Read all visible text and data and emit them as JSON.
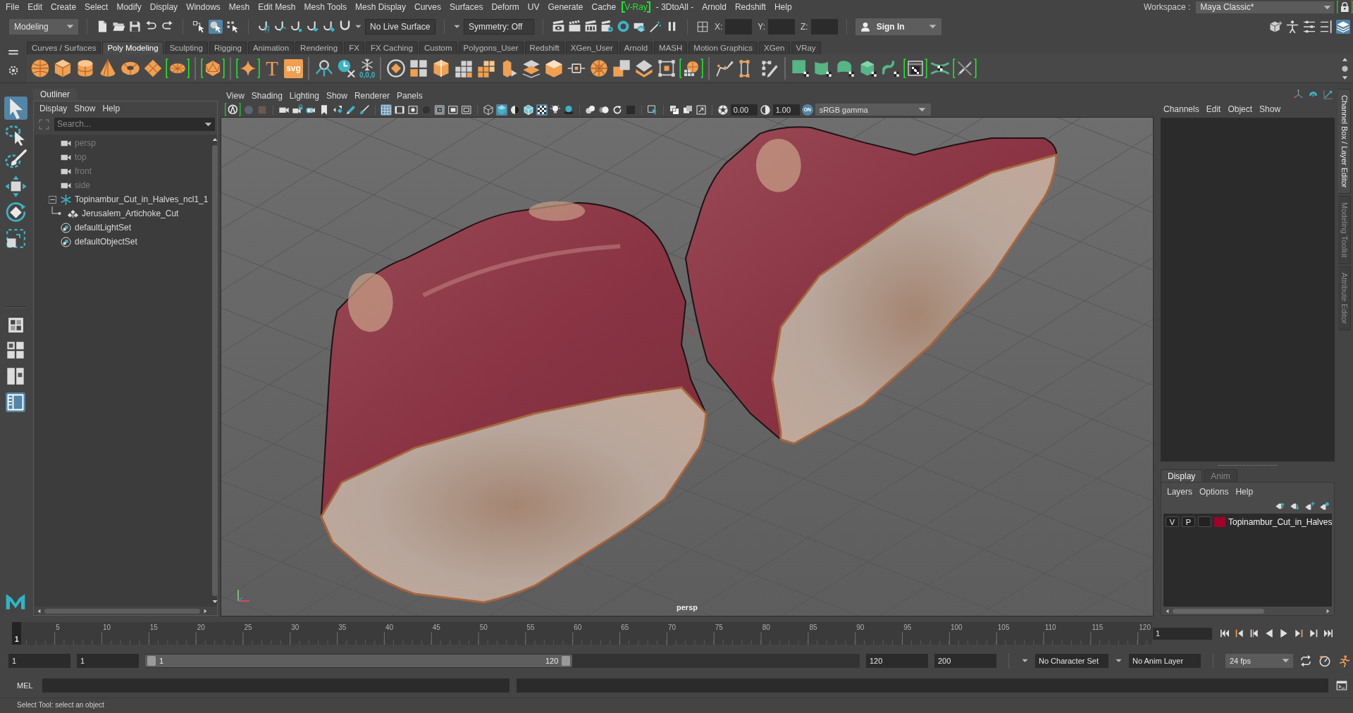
{
  "menu_bar": {
    "items": [
      {
        "label": "File",
        "highlighted": false
      },
      {
        "label": "Edit",
        "highlighted": false
      },
      {
        "label": "Create",
        "highlighted": false
      },
      {
        "label": "Select",
        "highlighted": false
      },
      {
        "label": "Modify",
        "highlighted": false
      },
      {
        "label": "Display",
        "highlighted": false
      },
      {
        "label": "Windows",
        "highlighted": false
      },
      {
        "label": "Mesh",
        "highlighted": false
      },
      {
        "label": "Edit Mesh",
        "highlighted": false
      },
      {
        "label": "Mesh Tools",
        "highlighted": false
      },
      {
        "label": "Mesh Display",
        "highlighted": false
      },
      {
        "label": "Curves",
        "highlighted": false
      },
      {
        "label": "Surfaces",
        "highlighted": false
      },
      {
        "label": "Deform",
        "highlighted": false
      },
      {
        "label": "UV",
        "highlighted": false
      },
      {
        "label": "Generate",
        "highlighted": false
      },
      {
        "label": "Cache",
        "highlighted": false
      },
      {
        "label": "V-Ray",
        "highlighted": true
      },
      {
        "label": "- 3DtoAll -",
        "highlighted": false
      },
      {
        "label": "Arnold",
        "highlighted": false
      },
      {
        "label": "Redshift",
        "highlighted": false
      },
      {
        "label": "Help",
        "highlighted": false
      }
    ],
    "workspace_label": "Workspace :",
    "workspace": "Maya Classic*",
    "lock": {
      "highlighted": true
    }
  },
  "status_line": {
    "mode": "Modeling",
    "selection_masks": [
      {
        "on": false
      },
      {
        "on": true
      },
      {
        "on": false
      }
    ],
    "live_surface": "No Live Surface",
    "symmetry": "Symmetry: Off",
    "coordinates": [
      {
        "label": "X:"
      },
      {
        "label": "Y:"
      },
      {
        "label": "Z:"
      }
    ],
    "sign_in": "Sign In",
    "panel_toggles": [
      {
        "on": false
      },
      {
        "on": false
      },
      {
        "on": false
      },
      {
        "on": false
      },
      {
        "on": true
      }
    ]
  },
  "shelf": {
    "tabs": [
      {
        "label": "Curves / Surfaces",
        "selected": false
      },
      {
        "label": "Poly Modeling",
        "selected": true
      },
      {
        "label": "Sculpting",
        "selected": false
      },
      {
        "label": "Rigging",
        "selected": false
      },
      {
        "label": "Animation",
        "selected": false
      },
      {
        "label": "Rendering",
        "selected": false
      },
      {
        "label": "FX",
        "selected": false
      },
      {
        "label": "FX Caching",
        "selected": false
      },
      {
        "label": "Custom",
        "selected": false
      },
      {
        "label": "Polygons_User",
        "selected": false
      },
      {
        "label": "Redshift",
        "selected": false
      },
      {
        "label": "XGen_User",
        "selected": false
      },
      {
        "label": "Arnold",
        "selected": false
      },
      {
        "label": "MASH",
        "selected": false
      },
      {
        "label": "Motion Graphics",
        "selected": false
      },
      {
        "label": "XGen",
        "selected": false
      },
      {
        "label": "VRay",
        "selected": false
      }
    ],
    "groups": [
      [
        {
          "kind": "icon",
          "highlighted": false
        },
        {
          "kind": "icon",
          "highlighted": false
        },
        {
          "kind": "icon",
          "highlighted": false
        },
        {
          "kind": "icon",
          "highlighted": false
        },
        {
          "kind": "icon",
          "highlighted": false
        },
        {
          "kind": "icon",
          "highlighted": false
        },
        {
          "kind": "icon",
          "highlighted": true
        }
      ],
      [
        {
          "kind": "icon",
          "highlighted": true
        }
      ],
      [
        {
          "kind": "icon",
          "highlighted": true
        },
        {
          "kind": "letter",
          "label": "T",
          "highlighted": false
        },
        {
          "kind": "tile",
          "label": "svg",
          "highlighted": false
        }
      ],
      [
        {
          "kind": "icon",
          "highlighted": false
        },
        {
          "kind": "icon",
          "highlighted": false
        },
        {
          "kind": "captioned",
          "label": "0,0,0",
          "highlighted": false
        }
      ],
      [
        {
          "kind": "icon",
          "highlighted": false
        },
        {
          "kind": "icon",
          "highlighted": false
        },
        {
          "kind": "icon",
          "highlighted": false
        },
        {
          "kind": "icon",
          "highlighted": false
        },
        {
          "kind": "icon",
          "highlighted": false
        },
        {
          "kind": "icon",
          "highlighted": false
        },
        {
          "kind": "icon",
          "highlighted": false
        },
        {
          "kind": "icon",
          "highlighted": false
        },
        {
          "kind": "icon",
          "highlighted": false
        },
        {
          "kind": "icon",
          "highlighted": false
        },
        {
          "kind": "icon",
          "highlighted": false
        },
        {
          "kind": "icon",
          "highlighted": false
        },
        {
          "kind": "icon",
          "highlighted": false
        },
        {
          "kind": "icon",
          "highlighted": true
        }
      ],
      [
        {
          "kind": "icon",
          "highlighted": false
        },
        {
          "kind": "icon",
          "highlighted": false
        },
        {
          "kind": "icon",
          "highlighted": false
        }
      ],
      [
        {
          "kind": "icon",
          "highlighted": false
        },
        {
          "kind": "icon",
          "highlighted": false
        },
        {
          "kind": "icon",
          "highlighted": false
        },
        {
          "kind": "icon",
          "highlighted": false
        },
        {
          "kind": "icon",
          "highlighted": false
        },
        {
          "kind": "icon",
          "highlighted": true
        },
        {
          "kind": "icon",
          "highlighted": false
        },
        {
          "kind": "icon",
          "highlighted": true
        }
      ]
    ]
  },
  "toolbox": {
    "tools": [
      {
        "selected": true
      },
      {
        "selected": false
      },
      {
        "selected": false
      },
      {
        "selected": false
      },
      {
        "selected": false
      },
      {
        "selected": false
      }
    ],
    "layouts": [
      {
        "selected": false
      },
      {
        "selected": false
      },
      {
        "selected": false
      },
      {
        "selected": true
      }
    ]
  },
  "outliner": {
    "title": "Outliner",
    "menu": [
      "Display",
      "Show",
      "Help"
    ],
    "search": {
      "placeholder": "Search..."
    },
    "items": [
      {
        "label": "persp",
        "kind": "camera",
        "dimmed": true,
        "selected": false
      },
      {
        "label": "top",
        "kind": "camera",
        "dimmed": true,
        "selected": false
      },
      {
        "label": "front",
        "kind": "camera",
        "dimmed": true,
        "selected": false
      },
      {
        "label": "side",
        "kind": "camera",
        "dimmed": true,
        "selected": false
      },
      {
        "label": "Topinambur_Cut_in_Halves_ncl1_1",
        "kind": "group",
        "dimmed": false,
        "selected": false,
        "expanded": true,
        "children": [
          {
            "label": "Jerusalem_Artichoke_Cut",
            "kind": "mesh",
            "dimmed": false,
            "selected": false
          }
        ]
      },
      {
        "label": "defaultLightSet",
        "kind": "set",
        "dimmed": false,
        "selected": false
      },
      {
        "label": "defaultObjectSet",
        "kind": "set",
        "dimmed": false,
        "selected": false
      }
    ]
  },
  "viewport": {
    "menu": [
      "View",
      "Shading",
      "Lighting",
      "Show",
      "Renderer",
      "Panels"
    ],
    "toolbar_groups": [
      [
        {
          "on": false,
          "highlighted": true
        },
        {
          "on": false,
          "highlighted": false
        },
        {
          "on": false,
          "highlighted": false
        }
      ],
      [
        {
          "on": false,
          "highlighted": false
        },
        {
          "on": false,
          "highlighted": false
        },
        {
          "on": false,
          "highlighted": false
        },
        {
          "on": false,
          "highlighted": false
        },
        {
          "on": false,
          "highlighted": false
        },
        {
          "on": false,
          "highlighted": false
        },
        {
          "on": false,
          "highlighted": false
        }
      ],
      [
        {
          "on": true,
          "highlighted": false
        },
        {
          "on": false,
          "highlighted": false
        },
        {
          "on": false,
          "highlighted": false
        },
        {
          "on": false,
          "highlighted": false
        },
        {
          "on": false,
          "highlighted": false
        },
        {
          "on": false,
          "highlighted": false
        },
        {
          "on": false,
          "highlighted": false
        }
      ],
      [
        {
          "on": false,
          "highlighted": false
        },
        {
          "on": true,
          "highlighted": false
        },
        {
          "on": false,
          "highlighted": false
        },
        {
          "on": false,
          "highlighted": false
        },
        {
          "on": true,
          "highlighted": false
        },
        {
          "on": false,
          "highlighted": false
        },
        {
          "on": false,
          "highlighted": false
        }
      ],
      [
        {
          "on": false,
          "highlighted": false
        },
        {
          "on": false,
          "highlighted": false
        },
        {
          "on": false,
          "highlighted": false
        },
        {
          "on": false,
          "highlighted": false
        }
      ],
      [
        {
          "on": false,
          "highlighted": false
        }
      ],
      [
        {
          "on": false,
          "highlighted": false
        },
        {
          "on": false,
          "highlighted": false
        },
        {
          "on": false,
          "highlighted": false
        }
      ]
    ],
    "exposure": "0.00",
    "gamma": "1.00",
    "color_management": {
      "label": "ON",
      "on": true
    },
    "view_transform": "sRGB gamma",
    "camera": "persp"
  },
  "channel_box": {
    "menu": [
      "Channels",
      "Edit",
      "Object",
      "Show"
    ]
  },
  "layer_editor": {
    "tabs": [
      {
        "label": "Display",
        "selected": true
      },
      {
        "label": "Anim",
        "selected": false
      }
    ],
    "menu": [
      "Layers",
      "Options",
      "Help"
    ],
    "layers": [
      {
        "visibility": "V",
        "playback": "P",
        "name": "Topinambur_Cut_in_Halves",
        "color": "#a0002a"
      }
    ]
  },
  "side_tabs": [
    {
      "label": "Channel Box / Layer Editor",
      "selected": true
    },
    {
      "label": "Modeling Toolkit",
      "selected": false
    },
    {
      "label": "Attribute Editor",
      "selected": false
    }
  ],
  "time_slider": {
    "tick_labels": [
      "5",
      "10",
      "15",
      "20",
      "25",
      "30",
      "35",
      "40",
      "45",
      "50",
      "55",
      "60",
      "65",
      "70",
      "75",
      "80",
      "85",
      "90",
      "95",
      "100",
      "105",
      "110",
      "115",
      "120"
    ],
    "current_frame": "1",
    "current_frame_field": "1"
  },
  "range_slider": {
    "start": "1",
    "range_start": "1",
    "handle_start": "1",
    "handle_end": "120",
    "range_end": "120",
    "end": "200",
    "character_set": "No Character Set",
    "anim_layer": "No Anim Layer",
    "fps": "24 fps"
  },
  "command_line": {
    "language": "MEL"
  },
  "help_line": "Select Tool: select an object"
}
